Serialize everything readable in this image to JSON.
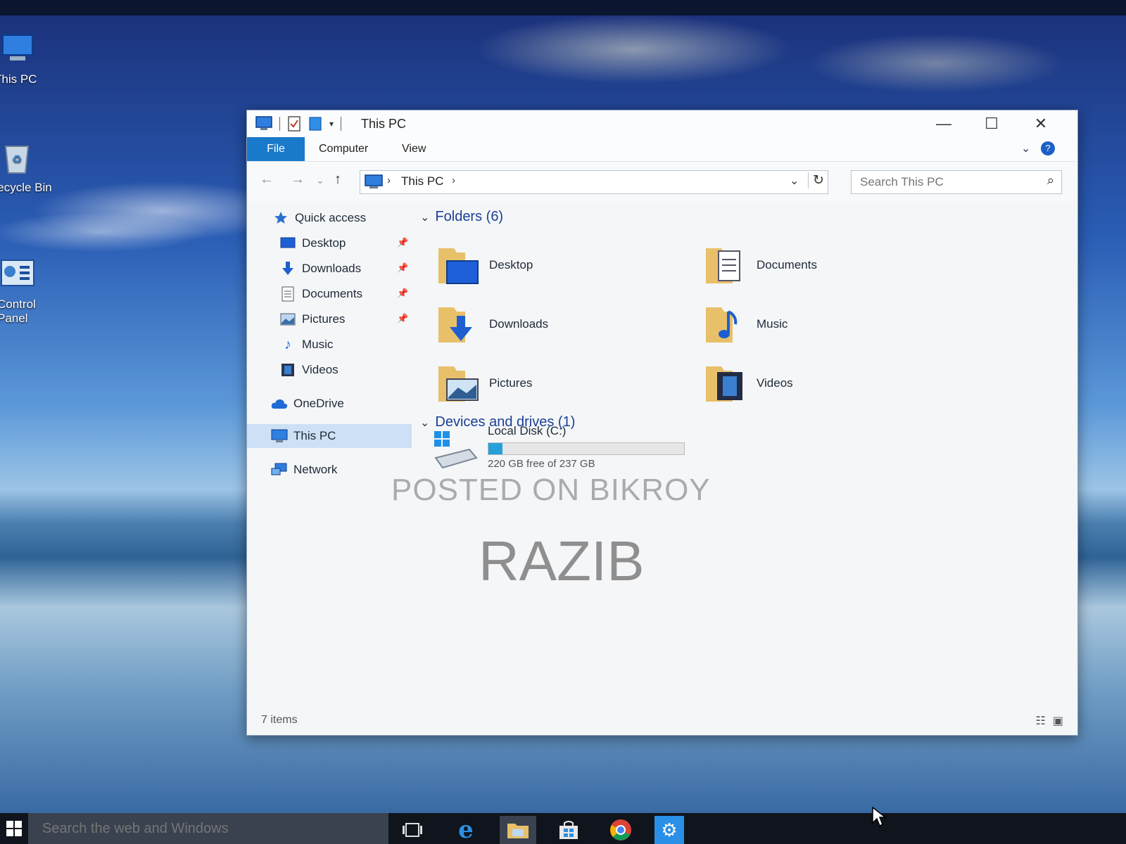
{
  "desktop": {
    "icons": [
      {
        "label": "This PC"
      },
      {
        "label": "Recycle Bin"
      },
      {
        "label": "Control Panel"
      }
    ]
  },
  "window": {
    "title": "This PC",
    "controls": {
      "minimize": "—",
      "maximize": "☐",
      "close": "✕"
    },
    "ribbon_tabs": [
      "File",
      "Computer",
      "View"
    ],
    "address_crumb": "This PC",
    "search_placeholder": "Search This PC",
    "nav": {
      "quick_access": "Quick access",
      "quick_items": [
        "Desktop",
        "Downloads",
        "Documents",
        "Pictures",
        "Music",
        "Videos"
      ],
      "onedrive": "OneDrive",
      "this_pc": "This PC",
      "network": "Network"
    },
    "folders_header": "Folders (6)",
    "folders": [
      "Desktop",
      "Documents",
      "Downloads",
      "Music",
      "Pictures",
      "Videos"
    ],
    "devices_header": "Devices and drives (1)",
    "drive": {
      "name": "Local Disk (C:)",
      "free_text": "220 GB free of 237 GB",
      "used_fraction": 0.072
    },
    "status_count": "7 items",
    "watermark_line1": "POSTED ON BIKROY",
    "watermark_line2": "RAZIB"
  },
  "taskbar": {
    "search_placeholder": "Search the web and Windows"
  },
  "colors": {
    "accent": "#1979ca",
    "folder": "#e8c06a",
    "link_blue": "#1c3f95"
  }
}
